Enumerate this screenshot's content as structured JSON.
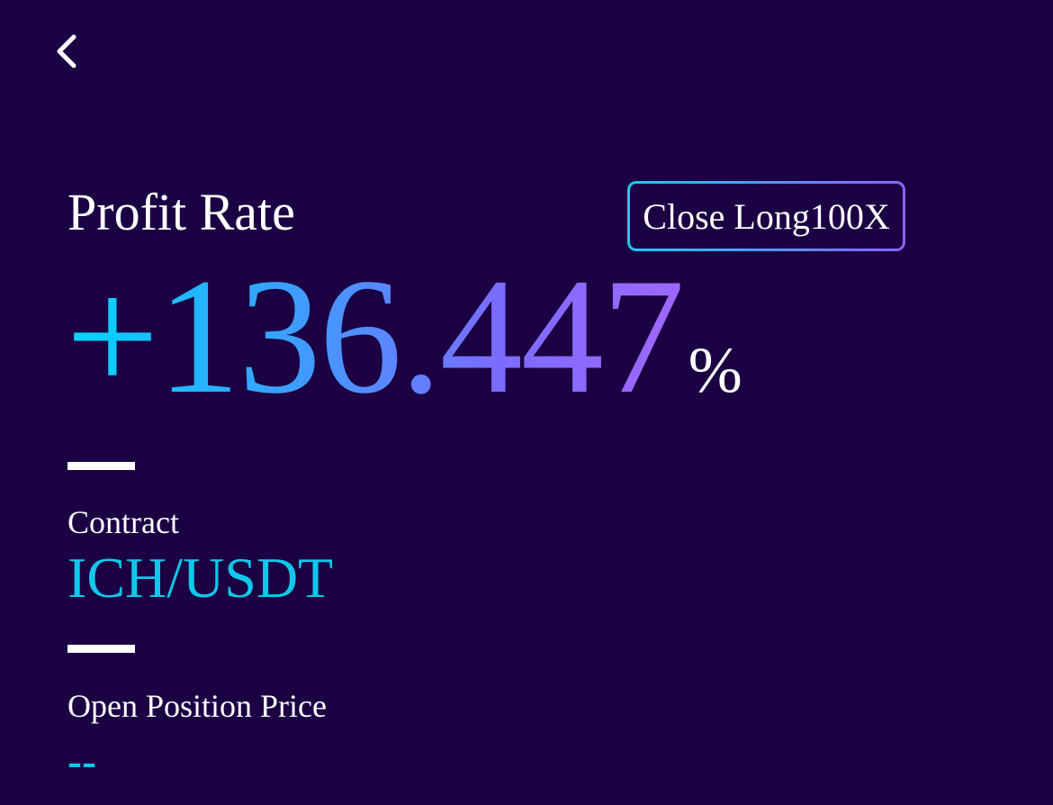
{
  "nav": {
    "back_icon": "chevron-left-icon"
  },
  "profit": {
    "label": "Profit Rate",
    "value": "+136.447",
    "unit": "%"
  },
  "position": {
    "badge": "Close Long100X"
  },
  "contract": {
    "label": "Contract",
    "value": "ICH/USDT"
  },
  "open_price": {
    "label": "Open Position Price",
    "value": "--"
  },
  "colors": {
    "background": "#1b0043",
    "accent_cyan": "#12c7ea",
    "accent_purple": "#a067ff",
    "text": "#ffffff"
  }
}
